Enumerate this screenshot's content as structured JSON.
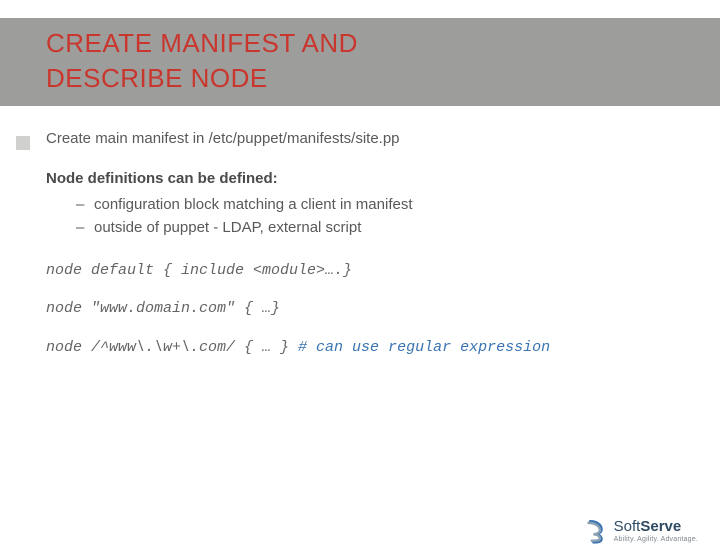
{
  "title_line1": "CREATE MANIFEST AND",
  "title_line2": "DESCRIBE NODE",
  "lead": "Create main manifest in /etc/puppet/manifests/site.pp",
  "sub_head": "Node definitions can be defined:",
  "bullets": {
    "b0": "configuration block matching a client in manifest",
    "b1": "outside of puppet - LDAP, external script"
  },
  "code": {
    "l1": "node default { include <module>….}",
    "l2": "node \"www.domain.com\" { …}",
    "l3a": "node  /^www\\.\\w+\\.com/ { … }     ",
    "l3b": "# can use regular expression"
  },
  "logo": {
    "brand_light": "Soft",
    "brand_bold": "Serve",
    "tag": "Ability. Agility. Advantage."
  }
}
